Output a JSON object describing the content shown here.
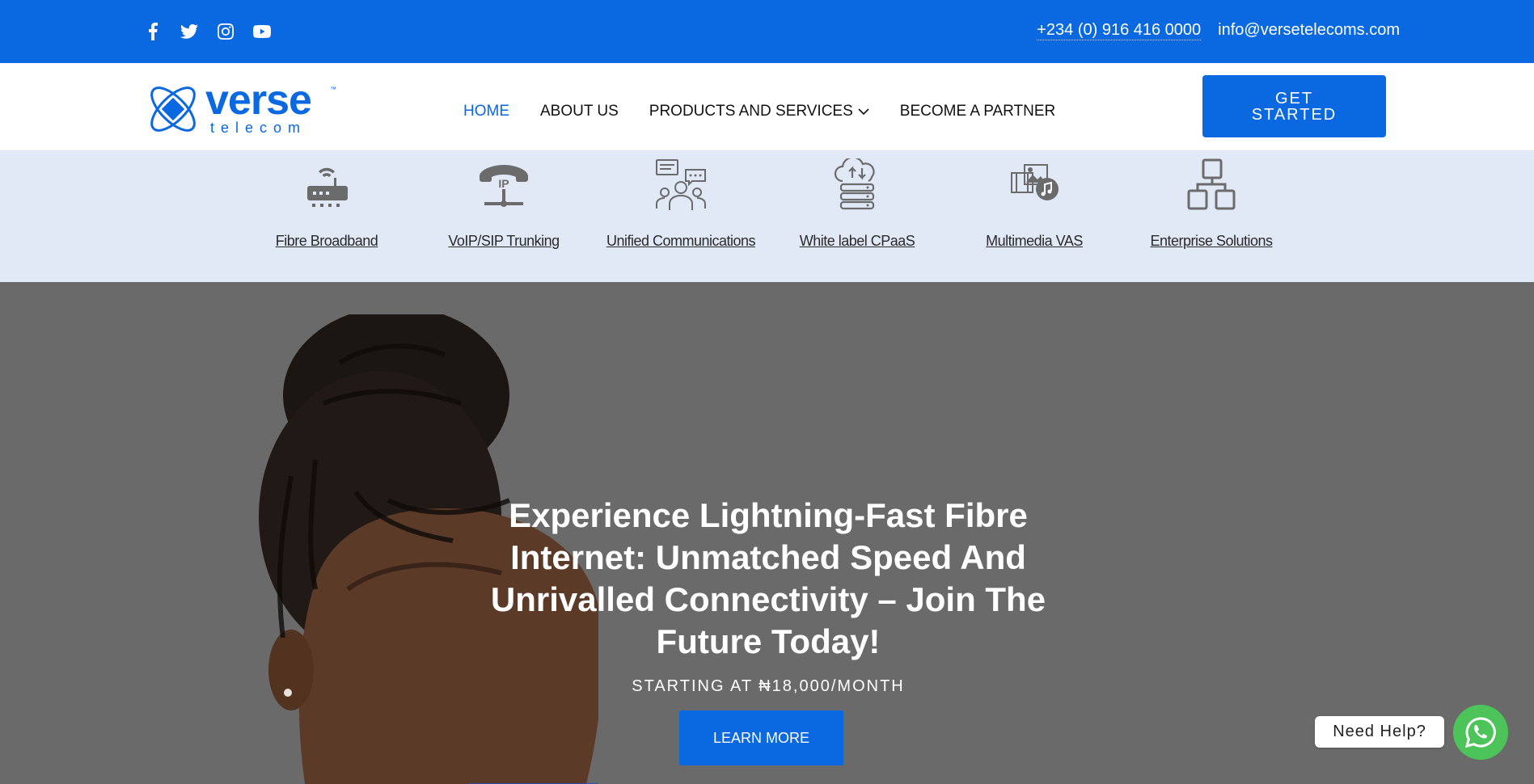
{
  "topbar": {
    "socials": [
      "facebook-icon",
      "twitter-icon",
      "instagram-icon",
      "youtube-icon"
    ],
    "phone": "+234 (0) 916 416 0000",
    "email": "info@versetelecoms.com"
  },
  "header": {
    "logo_primary": "verse",
    "logo_secondary": "telecom",
    "logo_tm": "™",
    "nav": [
      {
        "label": "HOME",
        "active": true
      },
      {
        "label": "ABOUT US",
        "active": false
      },
      {
        "label": "PRODUCTS AND SERVICES",
        "active": false,
        "dropdown": true
      },
      {
        "label": "BECOME A PARTNER",
        "active": false
      }
    ],
    "cta_line1": "GET",
    "cta_line2": "STARTED"
  },
  "services": [
    {
      "label": "Fibre Broadband",
      "icon": "router-icon"
    },
    {
      "label": "VoIP/SIP Trunking",
      "icon": "ip-phone-icon"
    },
    {
      "label": "Unified Communications",
      "icon": "team-chat-icon"
    },
    {
      "label": "White label CPaaS",
      "icon": "cloud-server-icon"
    },
    {
      "label": "Multimedia VAS",
      "icon": "multimedia-icon"
    },
    {
      "label": "Enterprise Solutions",
      "icon": "hierarchy-icon"
    }
  ],
  "hero": {
    "title": "Experience Lightning-Fast Fibre Internet: Unmatched Speed And Unrivalled Connectivity – Join The Future Today!",
    "subtitle": "STARTING AT ₦18,000/MONTH",
    "button": "LEARN MORE"
  },
  "chat": {
    "label": "Need Help?"
  },
  "colors": {
    "brand": "#0a68e0",
    "strip": "#e1e9f7",
    "hero_bg": "#6a6a6a",
    "whatsapp": "#4cc45a"
  }
}
